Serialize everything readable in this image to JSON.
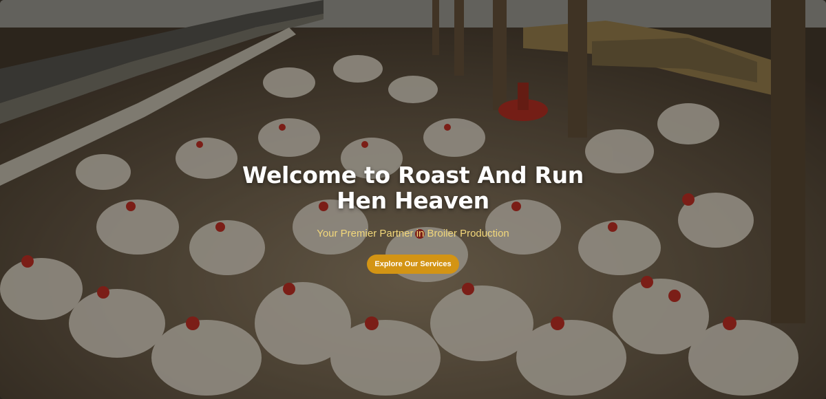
{
  "hero": {
    "title": "Welcome to Roast And Run Hen Heaven",
    "subtitle": "Your Premier Partner in Broiler Production",
    "cta_label": "Explore Our Services",
    "colors": {
      "title": "#ffffff",
      "subtitle": "#f2d77a",
      "cta_background": "#d39414",
      "cta_text": "#ffffff"
    },
    "background_image": "broiler-house-photo"
  }
}
